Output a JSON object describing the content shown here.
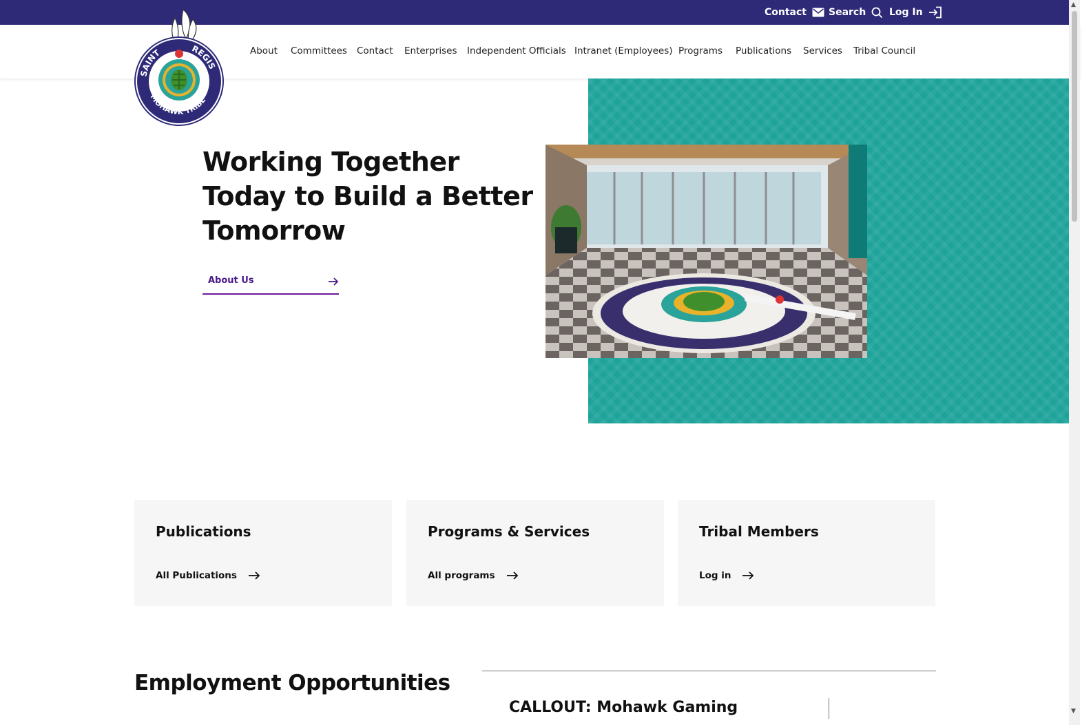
{
  "utility_nav": {
    "contact": "Contact",
    "search": "Search",
    "login": "Log In"
  },
  "main_nav": {
    "items": [
      "About",
      "Committees",
      "Contact",
      "Enterprises",
      "Independent Officials",
      "Intranet (Employees)",
      "Programs",
      "Publications",
      "Services",
      "Tribal Council"
    ]
  },
  "logo": {
    "top_text": "SAINT",
    "right_text": "REGIS",
    "bottom_text": "MOHAWK TRIBE"
  },
  "hero": {
    "title": "Working Together Today to Build a Better Tomorrow",
    "cta_label": "About Us"
  },
  "cards": [
    {
      "title": "Publications",
      "link": "All Publications"
    },
    {
      "title": "Programs & Services",
      "link": "All programs"
    },
    {
      "title": "Tribal Members",
      "link": "Log in"
    }
  ],
  "employment": {
    "heading": "Employment Opportunities",
    "callout": "CALLOUT: Mohawk Gaming"
  },
  "colors": {
    "topbar": "#2e2a78",
    "teal": "#1ea39a",
    "accent": "#6a1b9a"
  },
  "icons": {
    "contact": "envelope-icon",
    "search": "search-icon",
    "login": "login-icon",
    "cta": "arrow-right-icon"
  }
}
